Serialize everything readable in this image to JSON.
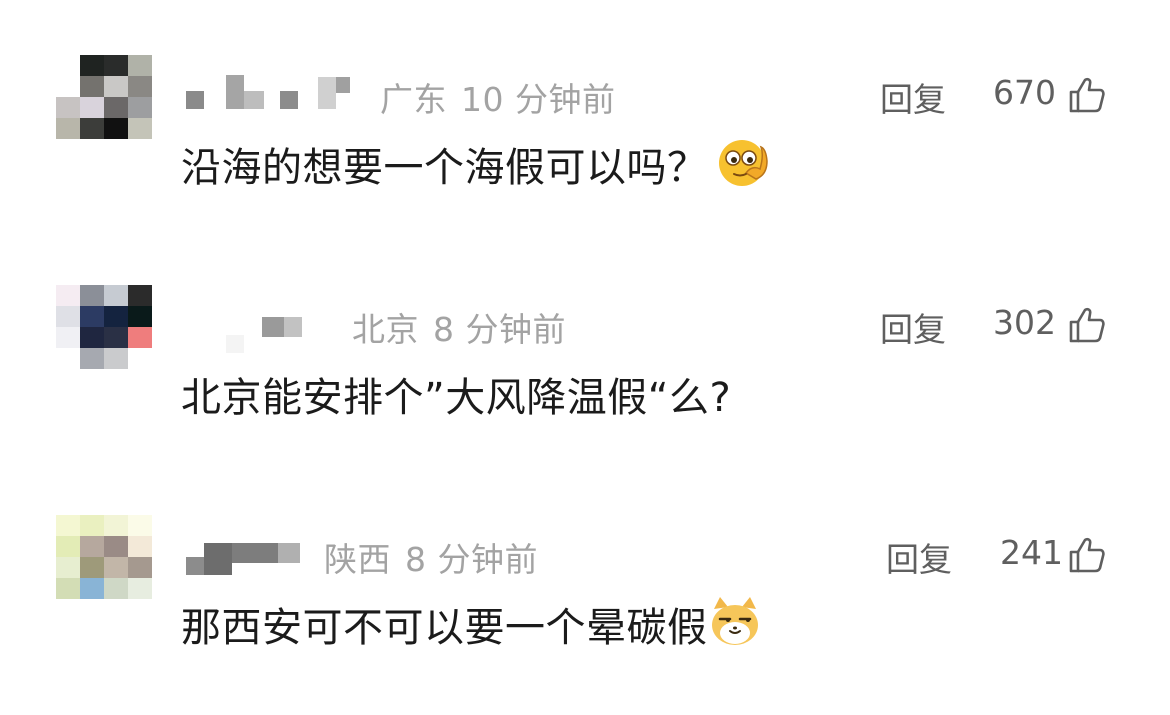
{
  "comments": [
    {
      "location": "广东",
      "time": "10 分钟前",
      "reply_label": "回复",
      "likes": "670",
      "text": "沿海的想要一个海假可以吗？",
      "emoji_icon": "thinking-face-emoji"
    },
    {
      "location": "北京",
      "time": "8 分钟前",
      "reply_label": "回复",
      "likes": "302",
      "text": "北京能安排个”大风降温假“么?"
    },
    {
      "location": "陕西",
      "time": "8 分钟前",
      "reply_label": "回复",
      "likes": "241",
      "text": "那西安可不可以要一个晕碳假",
      "emoji_icon": "smug-cat-emoji"
    }
  ],
  "icons": {
    "like": "thumbs-up-icon"
  },
  "colors": {
    "meta_text": "#a3a3a3",
    "action_text": "#5f5f5f",
    "body_text": "#1b1b1b"
  }
}
